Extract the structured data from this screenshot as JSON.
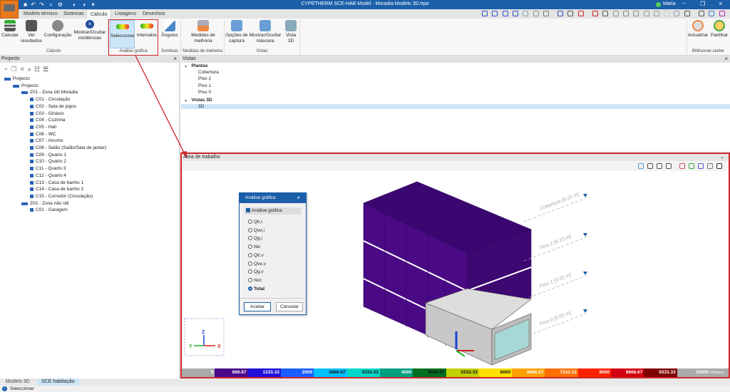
{
  "window": {
    "title": "CYPETHERM SCE-HAB Model - Moradia Modelo 3D.trpo",
    "user": "Maria",
    "app_icon_label": "SCE-HAB"
  },
  "tabs": [
    {
      "label": "Modelo térmico"
    },
    {
      "label": "Sistemas"
    },
    {
      "label": "Cálculo",
      "active": true
    },
    {
      "label": "Listagens"
    },
    {
      "label": "Desenhos"
    }
  ],
  "ribbon": {
    "buttons": [
      {
        "label": "Calcular"
      },
      {
        "label": "Ver resultados"
      },
      {
        "label": "Configuração"
      },
      {
        "label": "Mostrar/Ocultar incidências"
      },
      {
        "label": "Seleccionar"
      },
      {
        "label": "Intervalos"
      },
      {
        "label": "Ângulos"
      },
      {
        "label": "Medidas de melhoria"
      },
      {
        "label": "Opções de captura"
      },
      {
        "label": "Mostrar/Ocultar máscara"
      },
      {
        "label": "Vista 3D"
      },
      {
        "label": "Actualizar"
      },
      {
        "label": "Partilhar"
      }
    ],
    "groups": [
      "Cálculo",
      "Análise gráfica",
      "Sombras",
      "Medidas de melhoria",
      "Vistas",
      "BIMserver.center"
    ]
  },
  "left_panel": {
    "title": "Projecto",
    "tree": [
      {
        "label": "Projecto",
        "level": 0
      },
      {
        "label": "Projecto",
        "level": 1
      },
      {
        "label": "Z01 - Zona útil Moradia",
        "level": 2
      },
      {
        "label": "C01 - Circulação",
        "level": 3
      },
      {
        "label": "C02 - Sala de jogos",
        "level": 3
      },
      {
        "label": "C03 - Ginásio",
        "level": 3
      },
      {
        "label": "C04 - Cozinha",
        "level": 3
      },
      {
        "label": "C05 - Hall",
        "level": 3
      },
      {
        "label": "C06 - WC",
        "level": 3
      },
      {
        "label": "C07 - Arrumo",
        "level": 3
      },
      {
        "label": "C08 - Salão (Salão/Sala de jantar)",
        "level": 3
      },
      {
        "label": "C09 - Quarto 1",
        "level": 3
      },
      {
        "label": "C10 - Quarto 2",
        "level": 3
      },
      {
        "label": "C11 - Quarto 3",
        "level": 3
      },
      {
        "label": "C12 - Quarto 4",
        "level": 3
      },
      {
        "label": "C13 - Casa de banho 1",
        "level": 3
      },
      {
        "label": "C14 - Casa de banho 2",
        "level": 3
      },
      {
        "label": "C15 - Corredor (Circulação)",
        "level": 3
      },
      {
        "label": "Z02 - Zona não útil",
        "level": 2
      },
      {
        "label": "C01 - Garagem",
        "level": 3
      }
    ]
  },
  "vistas": {
    "title": "Vistas",
    "items": [
      {
        "label": "Plantas",
        "group": true
      },
      {
        "label": "Cobertura"
      },
      {
        "label": "Piso 2"
      },
      {
        "label": "Piso 1"
      },
      {
        "label": "Piso 0"
      },
      {
        "label": "Vistas 3D",
        "group": true
      },
      {
        "label": "3D",
        "selected": true
      }
    ]
  },
  "work_area": {
    "title": "Área de trabalho",
    "levels": [
      "Cobertura [9.25 m]",
      "Piso 2 [6.10 m]",
      "Piso 1 [3.05 m]",
      "Piso 0 [0.00 m]"
    ],
    "axes": {
      "x": "X",
      "y": "Y",
      "z": "Z"
    }
  },
  "dialog": {
    "title": "Análise gráfica",
    "checkbox": "Análise gráfica",
    "checked": true,
    "options": [
      "Qtr,i",
      "Qve,i",
      "Qg,i",
      "Nic",
      "Qtr,v",
      "Qve,v",
      "Qg,v",
      "Nvc",
      "Total"
    ],
    "selected": "Total",
    "ok": "Aceitar",
    "cancel": "Cancelar"
  },
  "legend": {
    "unit": "kWh/ano",
    "labels": [
      "0",
      "666.67",
      "1333.33",
      "2000",
      "2666.67",
      "3333.33",
      "4000",
      "4666.67",
      "5333.33",
      "6000",
      "6666.67",
      "7333.33",
      "8000",
      "8666.67",
      "9333.33",
      "10000"
    ],
    "colors": [
      "#aaaaaa",
      "#4b0a8c",
      "#2010d8",
      "#1a5cff",
      "#00c0ff",
      "#00d8c8",
      "#00a080",
      "#007020",
      "#c0d000",
      "#ffe000",
      "#ffa000",
      "#ff7000",
      "#ff2000",
      "#d00010",
      "#800000",
      "#aaaaaa"
    ]
  },
  "bottom_tabs": [
    {
      "label": "Modelo 3D"
    },
    {
      "label": "SCE habitação",
      "active": true
    }
  ],
  "status": {
    "text": "Seleccionar"
  },
  "colors": {
    "accent": "#1b5fa9",
    "highlight": "#d0282c",
    "building": "#4b0a8c"
  }
}
